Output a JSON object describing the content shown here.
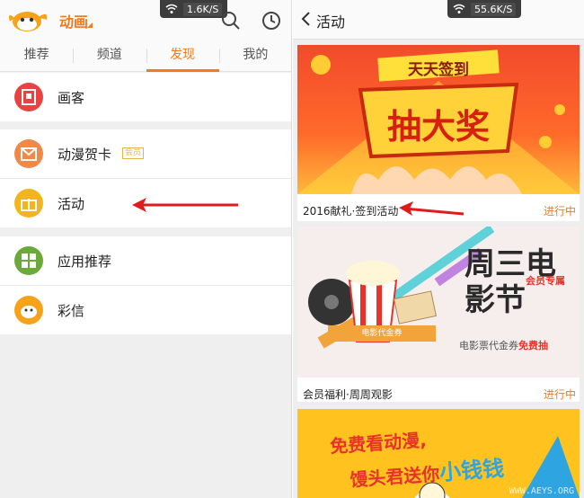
{
  "left": {
    "app_title": "动画",
    "status_speed": "1.6K/S",
    "tabs": [
      "推荐",
      "频道",
      "发现",
      "我的"
    ],
    "active_tab": "发现",
    "items": [
      {
        "label": "画客",
        "icon": "huake-icon",
        "color": "#e84343"
      },
      {
        "label": "动漫贺卡",
        "icon": "greeting-card-icon",
        "color": "#f0884a",
        "badge": "会员"
      },
      {
        "label": "活动",
        "icon": "gift-icon",
        "color": "#f3b51f"
      },
      {
        "label": "应用推荐",
        "icon": "apps-grid-icon",
        "color": "#6aa93a"
      },
      {
        "label": "彩信",
        "icon": "mascot-icon",
        "color": "#f7a21b"
      }
    ]
  },
  "right": {
    "title": "活动",
    "status_speed": "55.6K/S",
    "cards": [
      {
        "banner_line1": "天天签到",
        "banner_line2": "抽大奖",
        "caption": "2016献礼·签到活动",
        "status": "进行中"
      },
      {
        "banner_title": "周三电影节",
        "banner_tag": "会员专属",
        "banner_ticket": "电影代金券",
        "banner_sub_prefix": "电影票代金券",
        "banner_sub_highlight": "免费抽",
        "caption": "会员福利·周周观影",
        "status": "进行中"
      },
      {
        "banner_line1": "免费看动漫,",
        "banner_line2_prefix": "馒头君送你",
        "banner_line2_highlight": "小钱钱",
        "watermark": "WWW.AEYS.ORG"
      }
    ]
  },
  "colors": {
    "accent": "#f07a1e",
    "arrow": "#e01b1b"
  }
}
